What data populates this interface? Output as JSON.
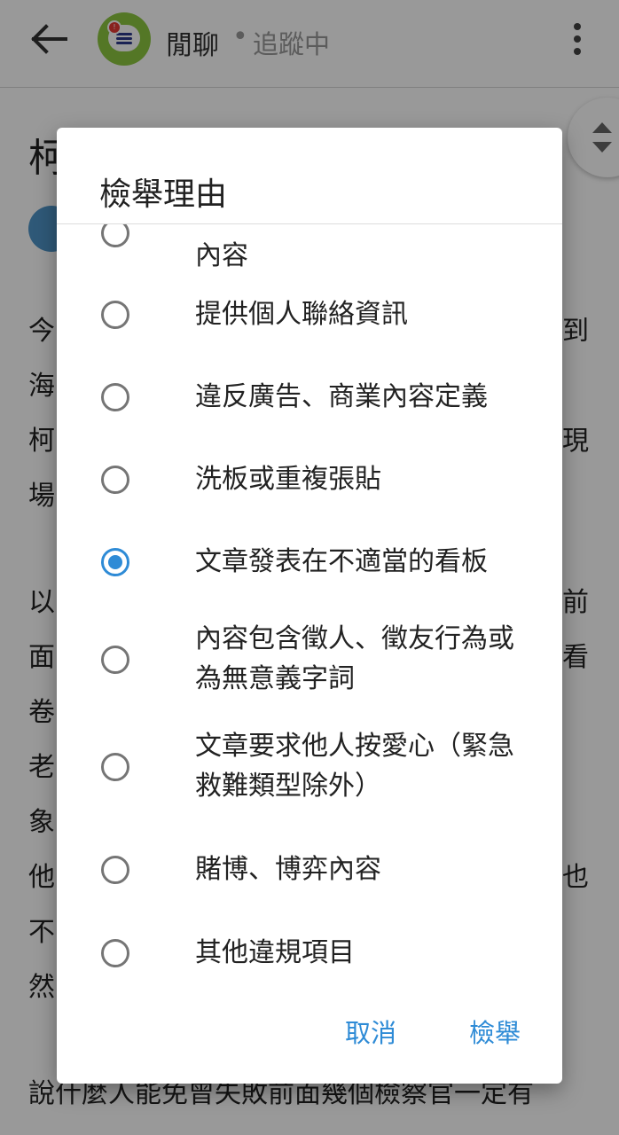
{
  "appbar": {
    "board_name": "閒聊",
    "separator": "•",
    "follow_status": "追蹤中",
    "icons": [
      "back-arrow-icon",
      "board-chat-icon",
      "more-vert-icon"
    ],
    "accent": "#8cc640"
  },
  "article": {
    "title_fragment": "柯",
    "line_left": [
      "今",
      "海",
      "柯",
      "場",
      "以",
      "面",
      "卷",
      "老",
      "象",
      "他",
      "不",
      "然"
    ],
    "line_right": [
      "到",
      "現",
      "前",
      "看",
      "也"
    ],
    "bottom_line": "說什麼人能免曾失敗前面幾個檢察官一定有"
  },
  "dialog": {
    "title": "檢舉理由",
    "partial_top_label": "內容",
    "options": [
      {
        "label": "提供個人聯絡資訊",
        "checked": false
      },
      {
        "label": "違反廣告、商業內容定義",
        "checked": false
      },
      {
        "label": "洗板或重複張貼",
        "checked": false
      },
      {
        "label": "文章發表在不適當的看板",
        "checked": true
      },
      {
        "label": "內容包含徵人、徵友行為或為無意義字詞",
        "checked": false
      },
      {
        "label": "文章要求他人按愛心（緊急救難類型除外）",
        "checked": false
      },
      {
        "label": "賭博、博弈內容",
        "checked": false
      },
      {
        "label": "其他違規項目",
        "checked": false
      }
    ],
    "cancel_label": "取消",
    "submit_label": "檢舉",
    "accent": "#2e8bd6"
  }
}
